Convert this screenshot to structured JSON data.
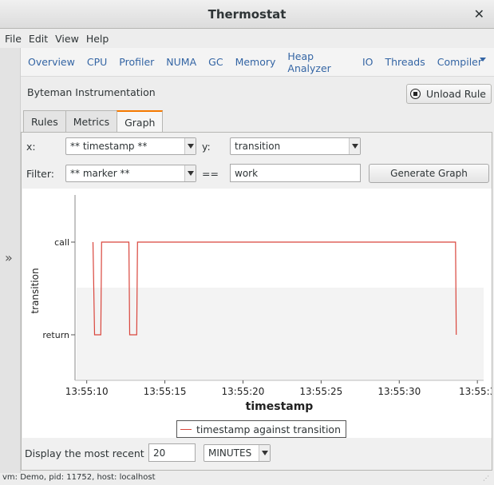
{
  "window": {
    "title": "Thermostat"
  },
  "menu": [
    "File",
    "Edit",
    "View",
    "Help"
  ],
  "nav": [
    "Overview",
    "CPU",
    "Profiler",
    "NUMA",
    "GC",
    "Memory",
    "Heap Analyzer",
    "IO",
    "Threads",
    "Compiler"
  ],
  "plugin": {
    "title": "Byteman Instrumentation",
    "unload_label": "Unload Rule"
  },
  "tabs": [
    "Rules",
    "Metrics",
    "Graph"
  ],
  "controls": {
    "x_label": "x:",
    "x_value": "** timestamp **",
    "y_label": "y:",
    "y_value": "transition",
    "filter_label": "Filter:",
    "filter_value": "** marker **",
    "eq_label": "==",
    "filter_text": "work",
    "generate_label": "Generate Graph"
  },
  "chart_data": {
    "type": "line",
    "xlabel": "timestamp",
    "ylabel": "transition",
    "x_ticks": [
      "13:55:10",
      "13:55:15",
      "13:55:20",
      "13:55:25",
      "13:55:30",
      "13:55:3"
    ],
    "y_categories": [
      "return",
      "call"
    ],
    "x_range_seconds": [
      9.25,
      35.4
    ],
    "series": [
      {
        "name": "timestamp against transition",
        "color": "#d9453c",
        "points": [
          [
            "13:55:10.4",
            "call"
          ],
          [
            "13:55:10.5",
            "return"
          ],
          [
            "13:55:10.9",
            "return"
          ],
          [
            "13:55:10.95",
            "call"
          ],
          [
            "13:55:12.7",
            "call"
          ],
          [
            "13:55:12.75",
            "return"
          ],
          [
            "13:55:13.2",
            "return"
          ],
          [
            "13:55:13.25",
            "call"
          ],
          [
            "13:55:33.6",
            "call"
          ],
          [
            "13:55:33.65",
            "return"
          ]
        ]
      }
    ],
    "legend": "timestamp against transition",
    "legend_position": "bottom"
  },
  "bottom": {
    "display_label": "Display the most recent",
    "display_value": "20",
    "unit_value": "MINUTES"
  },
  "status": {
    "text": "vm: Demo, pid: 11752, host: localhost"
  },
  "icons": {
    "close": "close-icon",
    "expand": "expand-sidebar-icon",
    "stop": "stop-icon",
    "menu_more": "chevron-down-icon"
  }
}
